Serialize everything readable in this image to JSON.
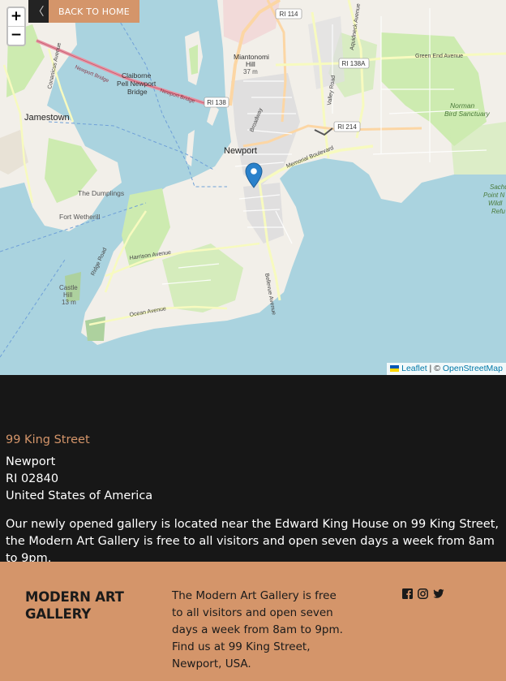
{
  "map": {
    "zoom_in_label": "+",
    "zoom_out_label": "−",
    "back_chevron": "〈",
    "back_label": "BACK TO HOME",
    "attribution": {
      "leaflet": "Leaflet",
      "separator": " | © ",
      "osm": "OpenStreetMap"
    },
    "labels": {
      "jamestown": "Jamestown",
      "newport": "Newport",
      "claiborne": "Claiborne",
      "pell_newport": "Pell Newport",
      "bridge": "Bridge",
      "newport_bridge_road": "Newport Bridge",
      "miantonomi": "Miantonomi",
      "hill": "Hill",
      "elev_37": "37 m",
      "the_dumplings": "The Dumplings",
      "fort_wetherill": "Fort Wetherill",
      "castle_hill": "Castle",
      "castle_hill2": "Hill",
      "elev_13": "13 m",
      "norman_bird": "Norman",
      "norman_bird2": "Bird Sanctuary",
      "sachuest": "Sachu",
      "sachuest2": "Point N",
      "sachuest3": "Wildl",
      "sachuest4": "Refu",
      "green_end": "Green End Avenue",
      "memorial": "Memorial Boulevard",
      "harrison": "Harrison Avenue",
      "ocean": "Ocean Avenue",
      "ridge": "Ridge Road",
      "bellevue": "Bellevue Avenue",
      "broadway": "Broadway",
      "valley": "Valley Road",
      "aquidneck": "Aquidneck Avenue",
      "conanicus": "Conanicus Avenue",
      "ri114": "RI 114",
      "ri138": "RI 138",
      "ri138a": "RI 138A",
      "ri214": "RI 214"
    }
  },
  "address": {
    "street": "99 King Street",
    "city": "Newport",
    "state_zip": "RI 02840",
    "country": "United States of America",
    "description": "Our newly opened gallery is located near the Edward King House on 99 King Street, the Modern Art Gallery is free to all visitors and open seven days a week from 8am to 9pm."
  },
  "footer": {
    "brand_line1": "MODERN ART",
    "brand_line2": "GALLERY",
    "info": "The Modern Art Gallery is free to all visitors and open seven days a week from 8am to 9pm. Find us at 99 King Street, Newport, USA.",
    "social": [
      "facebook-icon",
      "instagram-icon",
      "twitter-icon"
    ]
  },
  "colors": {
    "accent": "#d4956a",
    "background": "#171717",
    "water": "#aad3df",
    "marker": "#2a81cb"
  }
}
